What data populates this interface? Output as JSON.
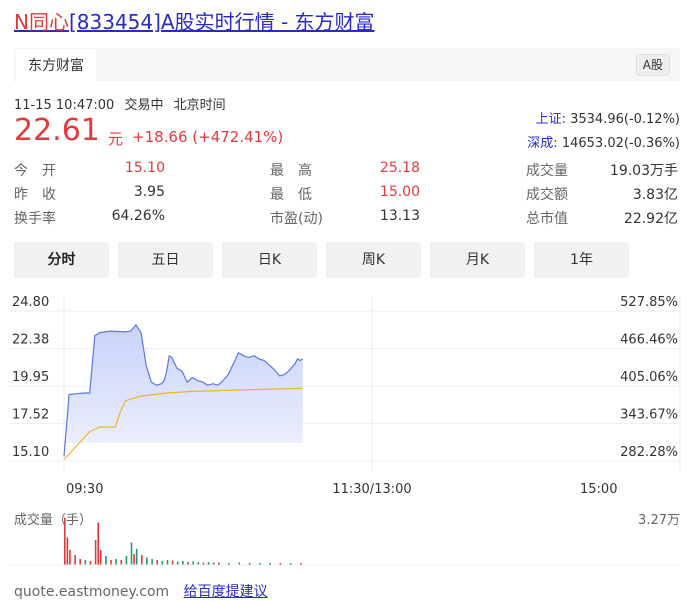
{
  "title": {
    "prefix": "N同心",
    "rest": "[833454]A股实时行情 - 东方财富"
  },
  "tab": {
    "label": "东方财富",
    "badge": "A股"
  },
  "meta": {
    "datetime": "11-15 10:47:00",
    "status": "交易中",
    "tz": "北京时间"
  },
  "quote": {
    "price": "22.61",
    "unit": "元",
    "change": "+18.66 (+472.41%)"
  },
  "indices": [
    {
      "name": "上证:",
      "value": "3534.96(-0.12%)"
    },
    {
      "name": "深成:",
      "value": "14653.02(-0.36%)"
    }
  ],
  "stats": {
    "open": {
      "label": "今　开",
      "value": "15.10"
    },
    "prev": {
      "label": "昨　收",
      "value": "3.95"
    },
    "turnover": {
      "label": "换手率",
      "value": "64.26%"
    },
    "high": {
      "label": "最　高",
      "value": "25.18"
    },
    "low": {
      "label": "最　低",
      "value": "15.00"
    },
    "pe": {
      "label": "市盈(动)",
      "value": "13.13"
    },
    "volume": {
      "label": "成交量",
      "value": "19.03万手"
    },
    "amount": {
      "label": "成交额",
      "value": "3.83亿"
    },
    "mcap": {
      "label": "总市值",
      "value": "22.92亿"
    }
  },
  "periods": [
    "分时",
    "五日",
    "日K",
    "周K",
    "月K",
    "1年"
  ],
  "chart_data": {
    "type": "line",
    "y_price": [
      "24.80",
      "22.38",
      "19.95",
      "17.52",
      "15.10"
    ],
    "y_pct": [
      "527.85%",
      "466.46%",
      "405.06%",
      "343.67%",
      "282.28%"
    ],
    "x_ticks": [
      "09:30",
      "11:30/13:00",
      "15:00"
    ],
    "ylim": [
      15.1,
      24.8
    ],
    "price_series": [
      [
        0,
        15.4
      ],
      [
        2,
        19.4
      ],
      [
        5,
        19.45
      ],
      [
        8,
        19.5
      ],
      [
        10,
        19.5
      ],
      [
        12,
        23.2
      ],
      [
        14,
        23.4
      ],
      [
        18,
        23.5
      ],
      [
        24,
        23.45
      ],
      [
        26,
        23.5
      ],
      [
        28,
        23.9
      ],
      [
        30,
        23.4
      ],
      [
        32,
        21.3
      ],
      [
        34,
        20.2
      ],
      [
        36,
        20.0
      ],
      [
        38,
        20.1
      ],
      [
        39,
        20.3
      ],
      [
        40,
        20.9
      ],
      [
        41,
        21.9
      ],
      [
        42,
        21.8
      ],
      [
        44,
        21.1
      ],
      [
        46,
        20.9
      ],
      [
        48,
        20.2
      ],
      [
        50,
        20.5
      ],
      [
        52,
        20.3
      ],
      [
        54,
        20.2
      ],
      [
        56,
        20.0
      ],
      [
        58,
        20.1
      ],
      [
        60,
        20.0
      ],
      [
        62,
        20.3
      ],
      [
        64,
        20.7
      ],
      [
        66,
        21.4
      ],
      [
        68,
        22.1
      ],
      [
        70,
        21.9
      ],
      [
        72,
        21.8
      ],
      [
        74,
        21.9
      ],
      [
        76,
        21.7
      ],
      [
        78,
        21.6
      ],
      [
        80,
        21.3
      ],
      [
        82,
        21.0
      ],
      [
        84,
        20.6
      ],
      [
        86,
        20.7
      ],
      [
        88,
        21.0
      ],
      [
        90,
        21.4
      ],
      [
        91,
        21.7
      ],
      [
        92,
        21.6
      ],
      [
        93,
        21.7
      ]
    ],
    "avg_series": [
      [
        0,
        15.2
      ],
      [
        10,
        17.0
      ],
      [
        14,
        17.3
      ],
      [
        20,
        17.3
      ],
      [
        22,
        18.3
      ],
      [
        24,
        19.0
      ],
      [
        30,
        19.3
      ],
      [
        40,
        19.5
      ],
      [
        50,
        19.6
      ],
      [
        60,
        19.65
      ],
      [
        70,
        19.7
      ],
      [
        80,
        19.75
      ],
      [
        93,
        19.8
      ]
    ],
    "volume": {
      "label": "成交量（手）",
      "max": "3.27万",
      "bars": [
        [
          0,
          0.95,
          "r"
        ],
        [
          1,
          0.55,
          "r"
        ],
        [
          2,
          0.3,
          "r"
        ],
        [
          4,
          0.2,
          "r"
        ],
        [
          6,
          0.12,
          "r"
        ],
        [
          8,
          0.1,
          "g"
        ],
        [
          10,
          0.08,
          "r"
        ],
        [
          12,
          0.5,
          "r"
        ],
        [
          13,
          0.85,
          "r"
        ],
        [
          14,
          0.3,
          "r"
        ],
        [
          16,
          0.18,
          "g"
        ],
        [
          18,
          0.1,
          "r"
        ],
        [
          20,
          0.12,
          "g"
        ],
        [
          22,
          0.1,
          "r"
        ],
        [
          24,
          0.18,
          "g"
        ],
        [
          26,
          0.45,
          "g"
        ],
        [
          27,
          0.22,
          "r"
        ],
        [
          28,
          0.32,
          "g"
        ],
        [
          30,
          0.2,
          "r"
        ],
        [
          32,
          0.15,
          "g"
        ],
        [
          34,
          0.12,
          "g"
        ],
        [
          36,
          0.1,
          "r"
        ],
        [
          38,
          0.08,
          "g"
        ],
        [
          40,
          0.1,
          "g"
        ],
        [
          42,
          0.09,
          "r"
        ],
        [
          44,
          0.07,
          "g"
        ],
        [
          46,
          0.08,
          "g"
        ],
        [
          48,
          0.06,
          "r"
        ],
        [
          50,
          0.07,
          "g"
        ],
        [
          52,
          0.06,
          "g"
        ],
        [
          54,
          0.05,
          "r"
        ],
        [
          56,
          0.06,
          "g"
        ],
        [
          58,
          0.05,
          "g"
        ],
        [
          60,
          0.05,
          "r"
        ],
        [
          64,
          0.04,
          "g"
        ],
        [
          68,
          0.05,
          "g"
        ],
        [
          72,
          0.04,
          "r"
        ],
        [
          76,
          0.04,
          "g"
        ],
        [
          80,
          0.04,
          "g"
        ],
        [
          84,
          0.04,
          "r"
        ],
        [
          88,
          0.04,
          "g"
        ],
        [
          92,
          0.04,
          "r"
        ]
      ]
    }
  },
  "footer": {
    "site": "quote.eastmoney.com",
    "link": "给百度提建议"
  },
  "colors": {
    "red": "#e4393c",
    "blue": "#2a2acc",
    "green": "#1e9c6e",
    "line": "#5b76e6",
    "avg": "#f0b429"
  }
}
